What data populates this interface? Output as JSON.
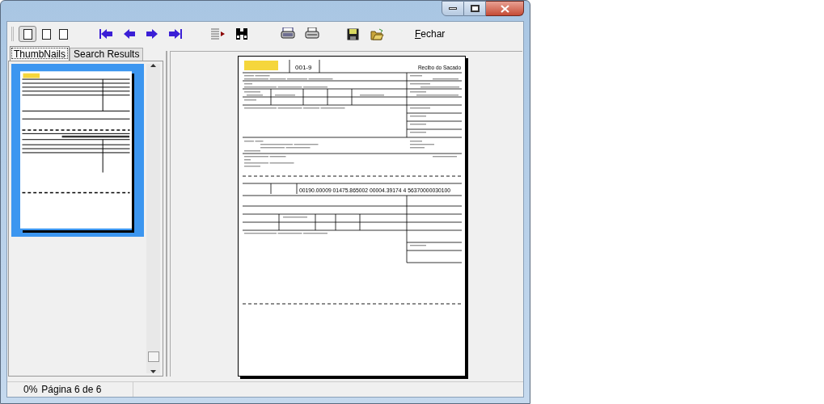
{
  "toolbar": {
    "view_modes": [
      {
        "selected": true
      },
      {
        "selected": false
      },
      {
        "selected": false
      }
    ],
    "close_label": "Fechar"
  },
  "tabs": [
    {
      "label": "ThumbNails",
      "selected": true
    },
    {
      "label": "Search Results",
      "selected": false
    }
  ],
  "thumbnails": [
    {
      "selected": true
    }
  ],
  "document": {
    "bank_code": "001-9",
    "title": "Recibo do Sacado",
    "digitable_line": "00190.00009 01475.865002 00004.39174 4 56370000030100"
  },
  "status_bar": {
    "progress": "0%",
    "page": "Página 6 de 6"
  }
}
